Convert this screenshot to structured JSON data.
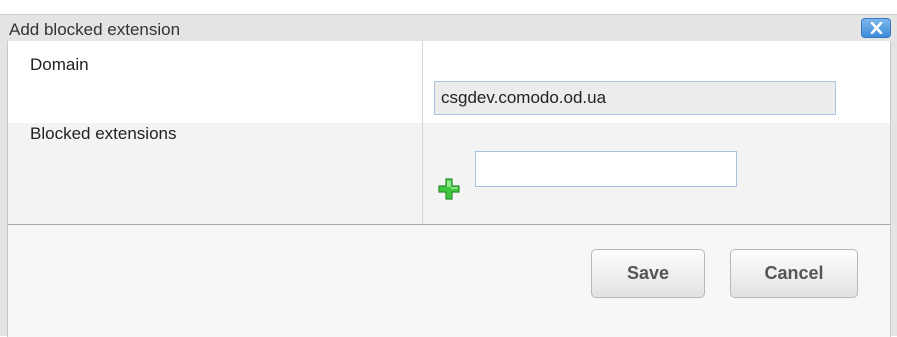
{
  "dialog": {
    "title": "Add blocked extension",
    "close_icon": "close-icon"
  },
  "form": {
    "domain_label": "Domain",
    "domain_value": "csgdev.comodo.od.ua",
    "blocked_label": "Blocked extensions",
    "blocked_value": "",
    "add_icon": "plus-icon"
  },
  "buttons": {
    "save_label": "Save",
    "cancel_label": "Cancel"
  },
  "colors": {
    "close_button": "#4a95dc",
    "add_icon": "#3fc83f"
  }
}
